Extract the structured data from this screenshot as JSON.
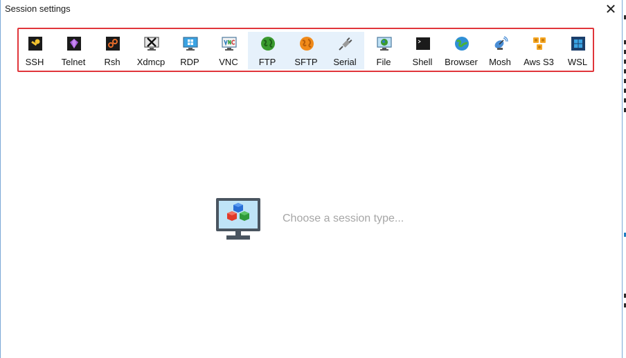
{
  "window": {
    "title": "Session settings"
  },
  "toolbar": {
    "items": [
      {
        "label": "SSH",
        "icon": "key-icon"
      },
      {
        "label": "Telnet",
        "icon": "gem-icon"
      },
      {
        "label": "Rsh",
        "icon": "chain-icon"
      },
      {
        "label": "Xdmcp",
        "icon": "x-monitor-icon"
      },
      {
        "label": "RDP",
        "icon": "windows-monitor-icon"
      },
      {
        "label": "VNC",
        "icon": "vnc-monitor-icon"
      },
      {
        "label": "FTP",
        "icon": "green-globe-icon"
      },
      {
        "label": "SFTP",
        "icon": "orange-globe-icon"
      },
      {
        "label": "Serial",
        "icon": "satellite-plug-icon"
      },
      {
        "label": "File",
        "icon": "globe-monitor-icon"
      },
      {
        "label": "Shell",
        "icon": "terminal-icon"
      },
      {
        "label": "Browser",
        "icon": "earth-icon"
      },
      {
        "label": "Mosh",
        "icon": "satellite-dish-icon"
      },
      {
        "label": "Aws S3",
        "icon": "cubes-icon"
      },
      {
        "label": "WSL",
        "icon": "windows-logo-icon"
      }
    ]
  },
  "main": {
    "prompt": "Choose a session type..."
  },
  "colors": {
    "toolbar_border": "#e0353a",
    "highlight": "#e6f1fb",
    "prompt_text": "#a6a6a6"
  }
}
